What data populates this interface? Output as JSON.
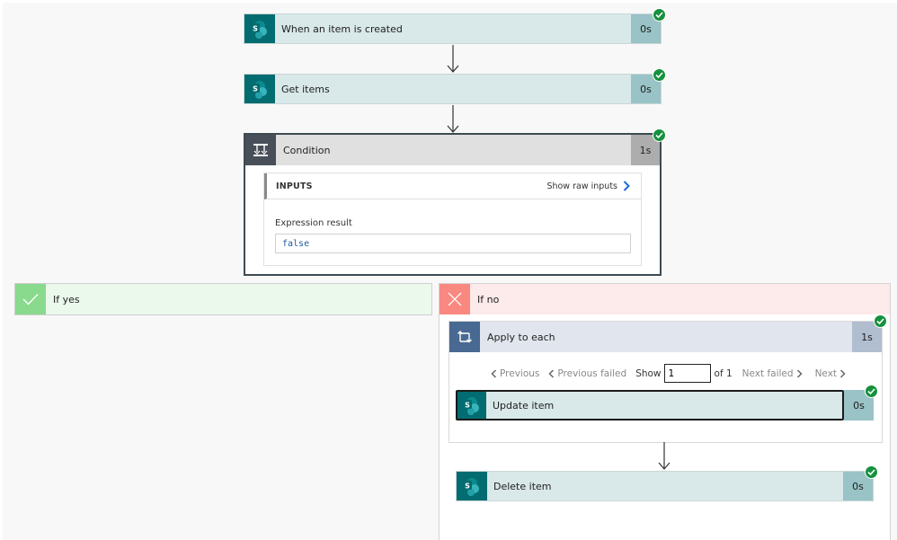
{
  "flow": {
    "trigger": {
      "title": "When an item is created",
      "duration": "0s",
      "status": "succeeded",
      "connector": "SharePoint"
    },
    "get_items": {
      "title": "Get items",
      "duration": "0s",
      "status": "succeeded",
      "connector": "SharePoint"
    },
    "condition": {
      "title": "Condition",
      "duration": "1s",
      "status": "succeeded",
      "inputs_label": "INPUTS",
      "show_raw_inputs": "Show raw inputs",
      "expression_label": "Expression result",
      "expression_value": "false"
    },
    "if_yes": {
      "label": "If yes"
    },
    "if_no": {
      "label": "If no",
      "apply_to_each": {
        "title": "Apply to each",
        "duration": "1s",
        "status": "succeeded",
        "pager": {
          "previous": "Previous",
          "previous_failed": "Previous failed",
          "show": "Show",
          "current": "1",
          "of": "of 1",
          "next_failed": "Next failed",
          "next": "Next"
        },
        "update_item": {
          "title": "Update item",
          "duration": "0s",
          "status": "succeeded",
          "connector": "SharePoint"
        }
      },
      "delete_item": {
        "title": "Delete item",
        "duration": "0s",
        "status": "succeeded",
        "connector": "SharePoint"
      }
    }
  },
  "colors": {
    "sharepoint": "#036c70",
    "success": "#16913e",
    "yes": "#89da8d",
    "no": "#f98880",
    "loop": "#486991",
    "condition": "#484f58",
    "link": "#1e6cd6"
  }
}
